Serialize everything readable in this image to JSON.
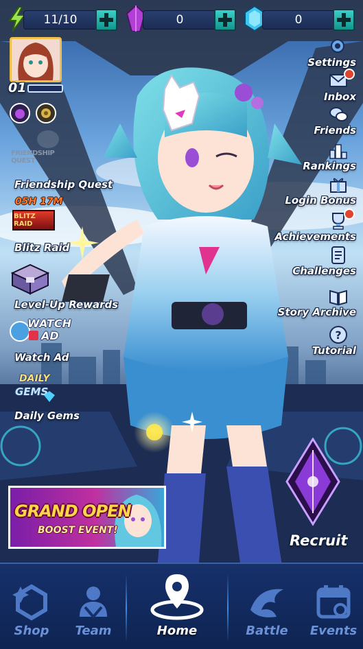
{
  "resources": {
    "energy": {
      "value": "11/10",
      "icon": "lightning-icon"
    },
    "crystals": {
      "value": "0",
      "icon": "purple-crystal-icon"
    },
    "gems": {
      "value": "0",
      "icon": "blue-gem-icon"
    }
  },
  "player": {
    "level": "01"
  },
  "left_menu": {
    "friendship_quest": {
      "label": "Friendship Quest",
      "logo_text": "FRIENDSHIP QUEST"
    },
    "blitz_raid": {
      "label": "Blitz Raid",
      "timer": "05H 17M",
      "logo_text": "BLITZ RAID"
    },
    "level_up": {
      "label": "Level-Up Rewards"
    },
    "watch_ad": {
      "label": "Watch Ad",
      "logo_text_1": "WATCH",
      "logo_text_2": "AD"
    },
    "daily_gems": {
      "label": "Daily Gems",
      "logo_text_1": "DAILY",
      "logo_text_2": "GEMS"
    }
  },
  "right_menu": [
    {
      "label": "Settings",
      "icon": "gear-icon",
      "badge": false
    },
    {
      "label": "Inbox",
      "icon": "envelope-icon",
      "badge": true
    },
    {
      "label": "Friends",
      "icon": "chat-bubbles-icon",
      "badge": false
    },
    {
      "label": "Rankings",
      "icon": "podium-icon",
      "badge": false
    },
    {
      "label": "Login Bonus",
      "icon": "gift-icon",
      "badge": false
    },
    {
      "label": "Achievements",
      "icon": "trophy-icon",
      "badge": true
    },
    {
      "label": "Challenges",
      "icon": "scroll-icon",
      "badge": false
    },
    {
      "label": "Story Archive",
      "icon": "book-icon",
      "badge": false
    },
    {
      "label": "Tutorial",
      "icon": "question-icon",
      "badge": false
    }
  ],
  "banner": {
    "title": "GRAND OPEN",
    "subtitle": "BOOST EVENT!"
  },
  "recruit": {
    "label": "Recruit"
  },
  "nav": {
    "shop": "Shop",
    "team": "Team",
    "home": "Home",
    "battle": "Battle",
    "events": "Events",
    "active": "home"
  },
  "colors": {
    "accent_teal": "#1fb5ad",
    "nav_bg": "#16306a",
    "nav_inactive": "#6b92d8",
    "badge_red": "#e0442f"
  }
}
